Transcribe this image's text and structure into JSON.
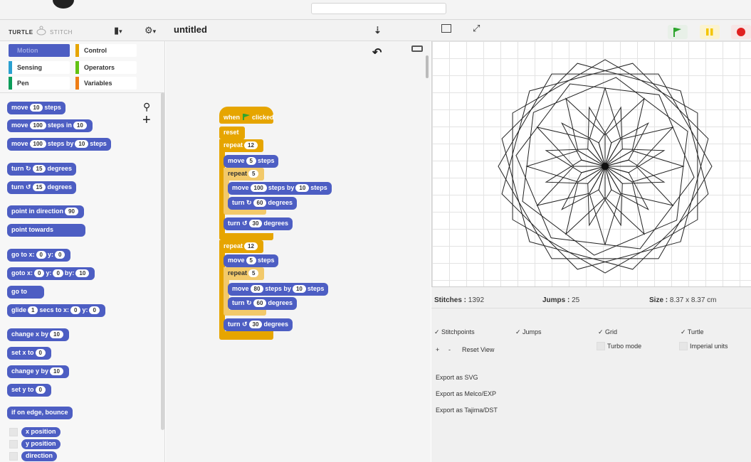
{
  "header": {
    "brand_turtle": "TURTLE",
    "brand_stitch": "STITCH",
    "file_icon": "file-icon",
    "settings_icon": "gear-icon",
    "project_title": "untitled",
    "cloud_icon": "cloud-icon",
    "normal_stage_icon": "normal-stage-icon",
    "fullscreen_icon": "fullscreen-icon",
    "green_flag_color": "#2ea52e",
    "pause_color": "#f4c500",
    "stop_color": "#e02020"
  },
  "palette": {
    "categories": [
      {
        "label": "Motion",
        "color": "#4d5ec3"
      },
      {
        "label": "Control",
        "color": "#e6a500"
      },
      {
        "label": "Sensing",
        "color": "#2aa0d0"
      },
      {
        "label": "Operators",
        "color": "#62c213"
      },
      {
        "label": "Pen",
        "color": "#0c9d5a"
      },
      {
        "label": "Variables",
        "color": "#ee7d16"
      }
    ],
    "blocks": {
      "move1": {
        "pre": "move",
        "v1": "10",
        "post": "steps"
      },
      "move2": {
        "pre": "move",
        "v1": "100",
        "mid": "steps in",
        "v2": "10"
      },
      "move3": {
        "pre": "move",
        "v1": "100",
        "mid": "steps by",
        "v2": "10",
        "post": "steps"
      },
      "turn_cw": {
        "pre": "turn ↻",
        "v1": "15",
        "post": "degrees"
      },
      "turn_ccw": {
        "pre": "turn ↺",
        "v1": "15",
        "post": "degrees"
      },
      "point_dir": {
        "pre": "point in direction",
        "v1": "90"
      },
      "point_towards": {
        "pre": "point towards"
      },
      "goto_xy": {
        "pre": "go to x:",
        "v1": "0",
        "mid": "y:",
        "v2": "0"
      },
      "goto_xyz": {
        "pre": "goto x:",
        "v1": "0",
        "mid": "y:",
        "v2": "0",
        "mid2": "by:",
        "v3": "10"
      },
      "goto": {
        "pre": "go to"
      },
      "glide": {
        "pre": "glide",
        "v1": "1",
        "mid": "secs to x:",
        "v2": "0",
        "mid2": "y:",
        "v3": "0"
      },
      "change_x": {
        "pre": "change x by",
        "v1": "10"
      },
      "set_x": {
        "pre": "set x to",
        "v1": "0"
      },
      "change_y": {
        "pre": "change y by",
        "v1": "10"
      },
      "set_y": {
        "pre": "set y to",
        "v1": "0"
      },
      "bounce": {
        "pre": "if on edge, bounce"
      },
      "xpos": {
        "pre": "x position"
      },
      "ypos": {
        "pre": "y position"
      },
      "direction": {
        "pre": "direction"
      }
    },
    "search_icon": "search-icon",
    "add_icon": "plus-icon"
  },
  "script": {
    "hat": {
      "pre": "when",
      "post": "clicked"
    },
    "reset": "reset",
    "repeat1": {
      "pre": "repeat",
      "v1": "12"
    },
    "move_a": {
      "pre": "move",
      "v1": "5",
      "post": "steps"
    },
    "repeat_inner1": {
      "pre": "repeat",
      "v1": "5"
    },
    "move_by1": {
      "pre": "move",
      "v1": "100",
      "mid": "steps by",
      "v2": "10",
      "post": "steps"
    },
    "turn_in1": {
      "pre": "turn ↻",
      "v1": "60",
      "post": "degrees"
    },
    "turn_out1": {
      "pre": "turn ↺",
      "v1": "30",
      "post": "degrees"
    },
    "repeat2": {
      "pre": "repeat",
      "v1": "12"
    },
    "move_b": {
      "pre": "move",
      "v1": "5",
      "post": "steps"
    },
    "repeat_inner2": {
      "pre": "repeat",
      "v1": "5"
    },
    "move_by2": {
      "pre": "move",
      "v1": "80",
      "mid": "steps by",
      "v2": "10",
      "post": "steps"
    },
    "turn_in2": {
      "pre": "turn ↻",
      "v1": "60",
      "post": "degrees"
    },
    "turn_out2": {
      "pre": "turn ↺",
      "v1": "30",
      "post": "degrees"
    },
    "undo_icon": "undo-icon",
    "keyboard_icon": "keyboard-icon"
  },
  "stats": {
    "stitches_label": "Stitches :",
    "stitches_value": "1392",
    "jumps_label": "Jumps :",
    "jumps_value": "25",
    "size_label": "Size :",
    "size_value": "8.37 x 8.37 cm"
  },
  "options": {
    "stitchpoints": "Stitchpoints",
    "jumps": "Jumps",
    "grid": "Grid",
    "turtle": "Turtle",
    "turbo": "Turbo mode",
    "imperial": "Imperial units",
    "zoom_in": "+",
    "zoom_out": "-",
    "reset_view": "Reset View"
  },
  "exports": {
    "svg": "Export as SVG",
    "exp": "Export as Melco/EXP",
    "dst": "Export as Tajima/DST"
  }
}
